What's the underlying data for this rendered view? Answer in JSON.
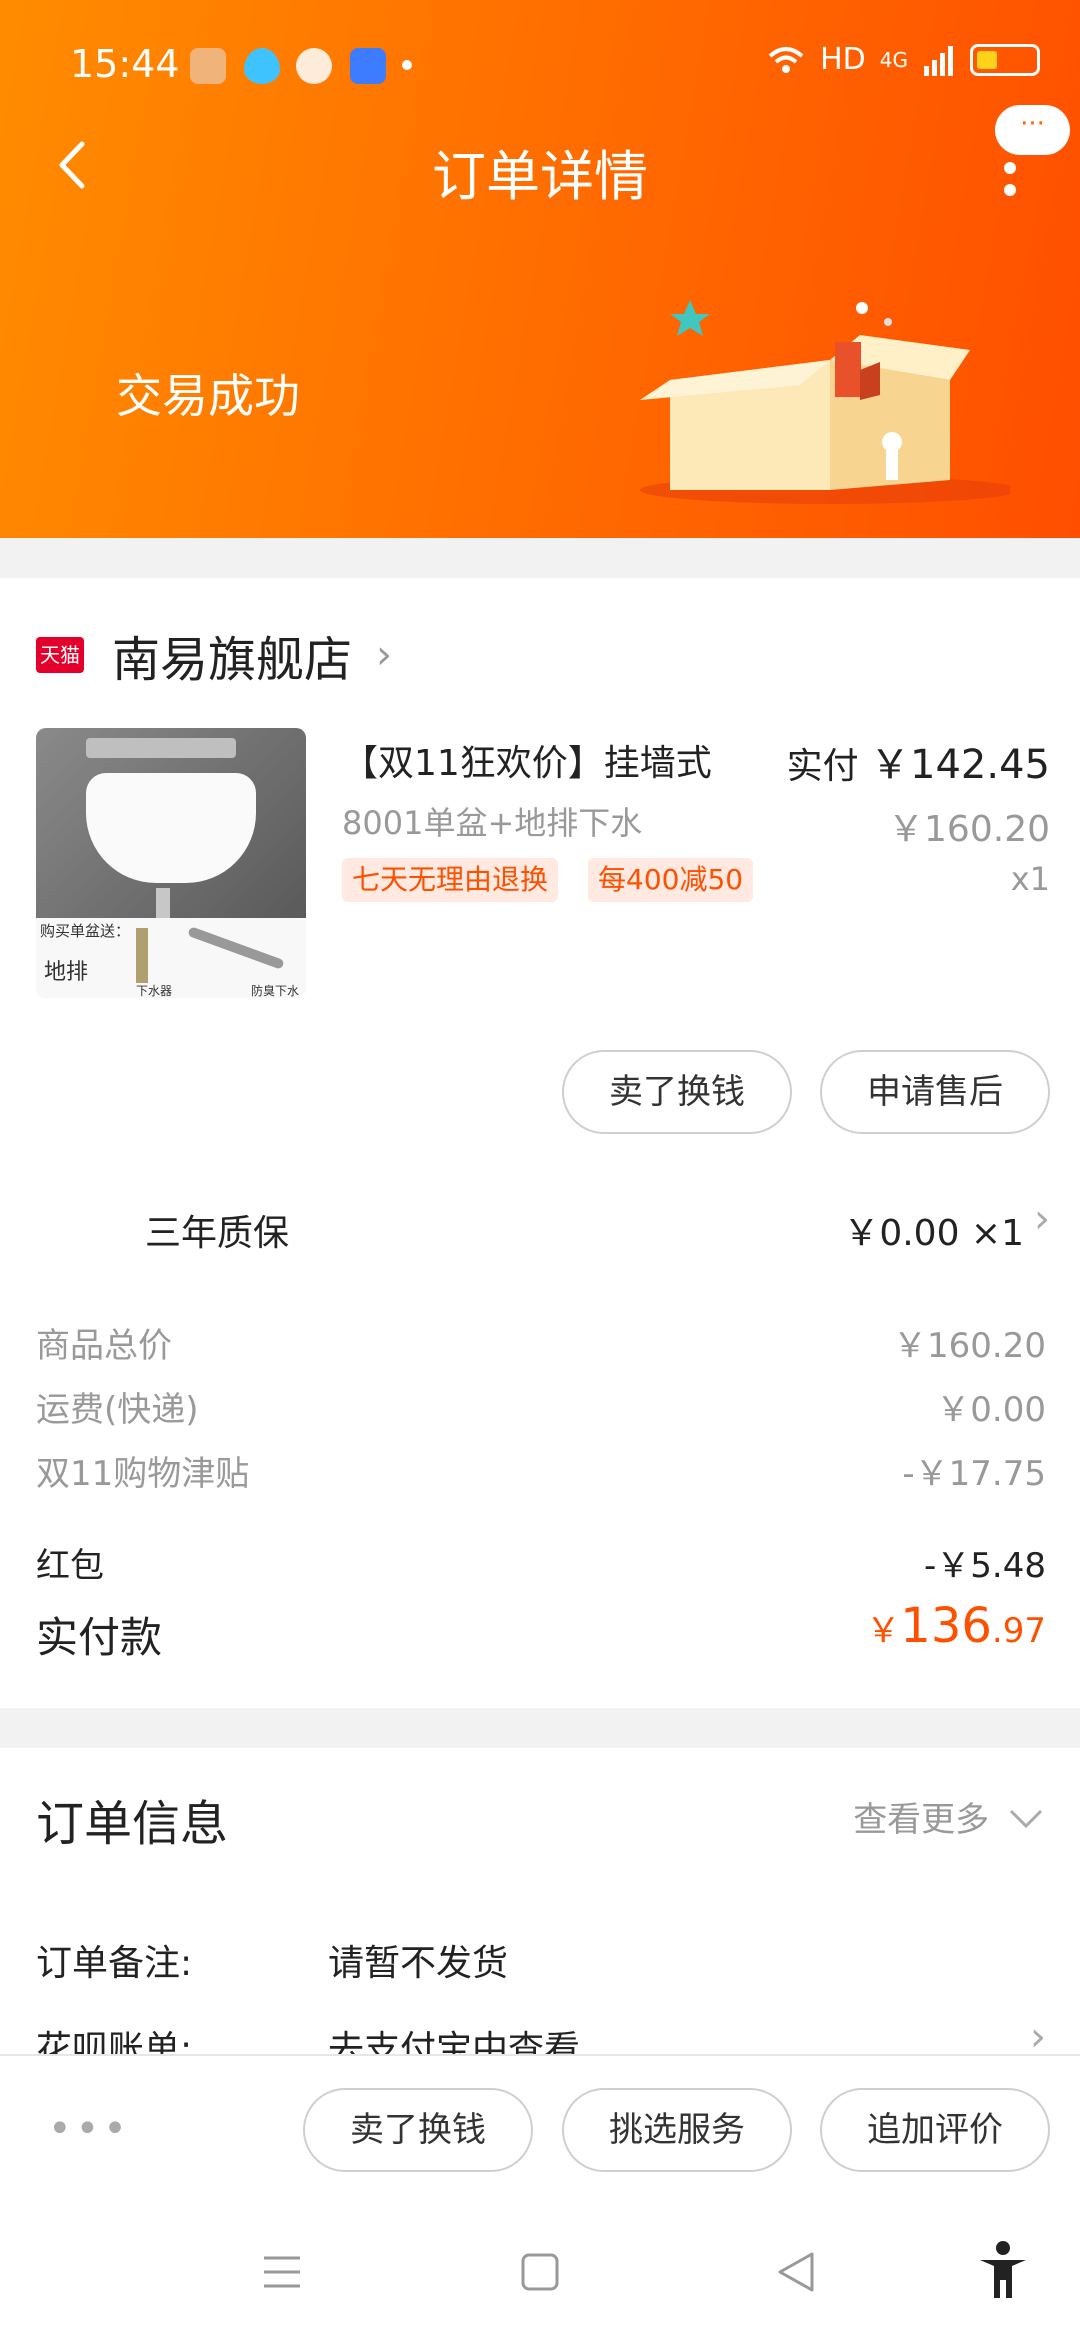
{
  "status_bar": {
    "time": "15:44",
    "network": "HD",
    "signal": "4G"
  },
  "nav": {
    "title": "订单详情",
    "chat_badge": "···"
  },
  "order_status": "交易成功",
  "shop": {
    "badge": "天猫",
    "name": "南易旗舰店"
  },
  "product": {
    "title": "【双11狂欢价】挂墙式",
    "spec": "8001单盆+地排下水",
    "tags": [
      "七天无理由退换",
      "每400减50"
    ],
    "paid_label": "实付",
    "paid_amount": "￥142.45",
    "original_price": "￥160.20",
    "quantity": "x1",
    "image_caption": "购买单盆送：",
    "image_label": "地排",
    "image_note_1": "下水器",
    "image_note_2": "防臭下水管"
  },
  "item_actions": [
    "卖了换钱",
    "申请售后"
  ],
  "warranty": {
    "label": "三年质保",
    "price": "￥0.00 ×1"
  },
  "fees": [
    {
      "label": "商品总价",
      "value": "￥160.20"
    },
    {
      "label": "运费(快递)",
      "value": "￥0.00"
    },
    {
      "label": "双11购物津贴",
      "value": "-￥17.75"
    },
    {
      "label": "红包",
      "value": "-￥5.48"
    }
  ],
  "total": {
    "label": "实付款",
    "currency": "￥",
    "integer": "136",
    "decimal": ".97"
  },
  "order_info": {
    "title": "订单信息",
    "more": "查看更多",
    "rows": [
      {
        "key": "订单备注:",
        "value": "请暂不发货"
      },
      {
        "key": "花呗账单:",
        "value": "去支付宝中查看"
      }
    ]
  },
  "bottom_actions": [
    "卖了换钱",
    "挑选服务",
    "追加评价"
  ],
  "colors": {
    "accent": "#ff5000",
    "header_start": "#ff8c00",
    "header_end": "#ff4e00"
  }
}
